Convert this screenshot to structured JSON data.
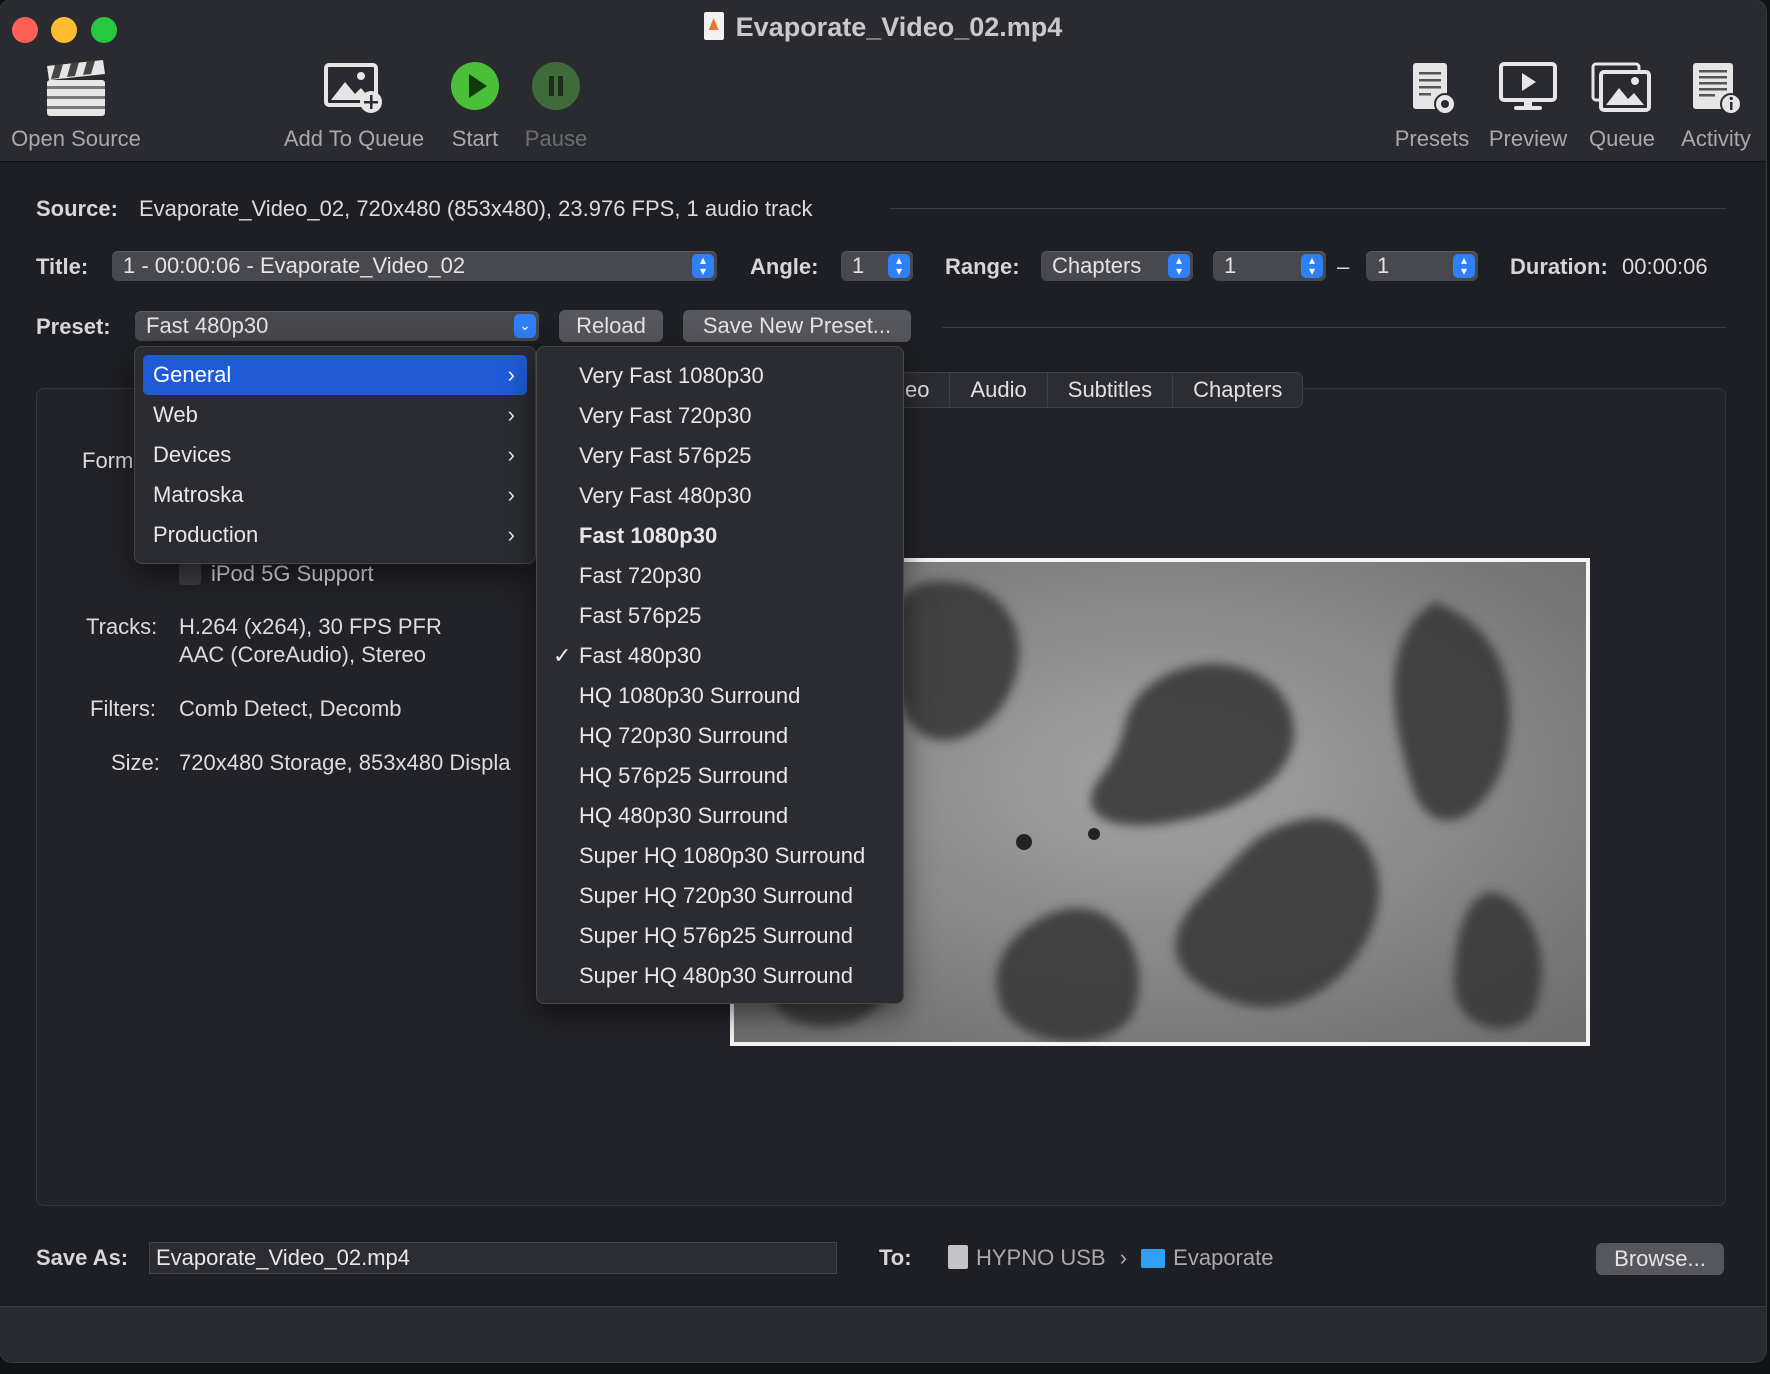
{
  "window": {
    "title": "Evaporate_Video_02.mp4"
  },
  "toolbar": {
    "open_source": "Open Source",
    "add_to_queue": "Add To Queue",
    "start": "Start",
    "pause": "Pause",
    "presets": "Presets",
    "preview": "Preview",
    "queue": "Queue",
    "activity": "Activity"
  },
  "source": {
    "label": "Source:",
    "value": "Evaporate_Video_02, 720x480 (853x480), 23.976 FPS, 1 audio track"
  },
  "title_row": {
    "title_label": "Title:",
    "title_value": "1 - 00:00:06 - Evaporate_Video_02",
    "angle_label": "Angle:",
    "angle_value": "1",
    "range_label": "Range:",
    "range_type": "Chapters",
    "range_start": "1",
    "range_dash": "–",
    "range_end": "1",
    "duration_label": "Duration:",
    "duration_value": "00:00:06"
  },
  "preset_row": {
    "label": "Preset:",
    "value": "Fast 480p30",
    "reload": "Reload",
    "save_new": "Save New Preset..."
  },
  "tabs": [
    "eo",
    "Audio",
    "Subtitles",
    "Chapters"
  ],
  "summary": {
    "format_label": "Form",
    "ipod_label": "iPod 5G Support",
    "tracks_label": "Tracks:",
    "tracks_line1": "H.264 (x264), 30 FPS PFR",
    "tracks_line2": "AAC (CoreAudio), Stereo",
    "filters_label": "Filters:",
    "filters_value": "Comb Detect, Decomb",
    "size_label": "Size:",
    "size_value": "720x480 Storage, 853x480 Displa"
  },
  "menu_categories": [
    {
      "label": "General",
      "chevron": "›"
    },
    {
      "label": "Web",
      "chevron": "›"
    },
    {
      "label": "Devices",
      "chevron": "›"
    },
    {
      "label": "Matroska",
      "chevron": "›"
    },
    {
      "label": "Production",
      "chevron": "›"
    }
  ],
  "menu_presets": [
    "Very Fast 1080p30",
    "Very Fast 720p30",
    "Very Fast 576p25",
    "Very Fast 480p30",
    "Fast 1080p30",
    "Fast 720p30",
    "Fast 576p25",
    "Fast 480p30",
    "HQ 1080p30 Surround",
    "HQ 720p30 Surround",
    "HQ 576p25 Surround",
    "HQ 480p30 Surround",
    "Super HQ 1080p30 Surround",
    "Super HQ 720p30 Surround",
    "Super HQ 576p25 Surround",
    "Super HQ 480p30 Surround"
  ],
  "menu_presets_checkmark": "✓",
  "save_row": {
    "save_as_label": "Save As:",
    "save_as_value": "Evaporate_Video_02.mp4",
    "to_label": "To:",
    "disk_name": "HYPNO USB",
    "path_sep": "›",
    "folder_name": "Evaporate",
    "browse": "Browse..."
  },
  "colors": {
    "accent": "#1f5bd6",
    "start_green": "#4cbf3a",
    "window_bg": "#1e1f24"
  }
}
